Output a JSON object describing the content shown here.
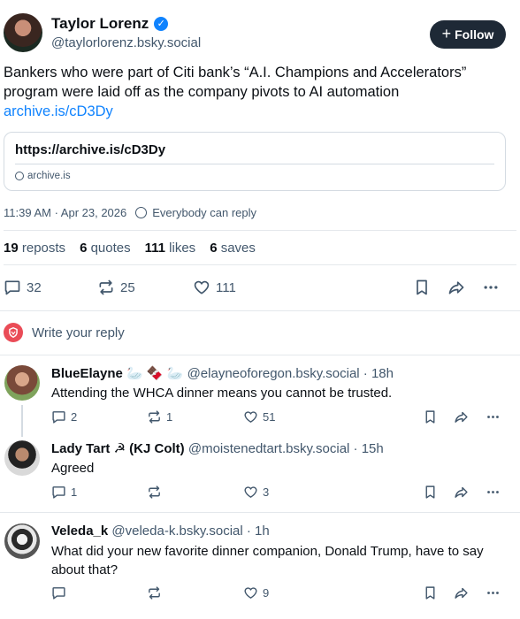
{
  "post": {
    "author_name": "Taylor Lorenz",
    "author_handle": "@taylorlorenz.bsky.social",
    "follow_label": "Follow",
    "text": "Bankers who were part of Citi bank’s “A.I. Champions and Accelerators” program were laid off as the company pivots to AI automation",
    "link_text": "archive.is/cD3Dy",
    "card": {
      "url": "https://archive.is/cD3Dy",
      "domain": "archive.is"
    },
    "timestamp": "11:39 AM · Apr 23, 2026",
    "reply_setting": "Everybody can reply",
    "stats": {
      "reposts_count": "19",
      "reposts_label": "reposts",
      "quotes_count": "6",
      "quotes_label": "quotes",
      "likes_count": "111",
      "likes_label": "likes",
      "saves_count": "6",
      "saves_label": "saves"
    },
    "actions": {
      "reply_count": "32",
      "repost_count": "25",
      "like_count": "111"
    }
  },
  "compose": {
    "placeholder": "Write your reply"
  },
  "replies": [
    {
      "name": "BlueElayne 🦢 🍫 🦢",
      "handle": "@elayneoforegon.bsky.social · 18h",
      "text": "Attending the WHCA dinner means you cannot be trusted.",
      "reply_count": "2",
      "repost_count": "1",
      "like_count": "51"
    },
    {
      "name": "Lady Tart ☭ (KJ Colt)",
      "handle": "@moistenedtart.bsky.social · 15h",
      "text": "Agreed",
      "reply_count": "1",
      "repost_count": "",
      "like_count": "3"
    },
    {
      "name": "Veleda_k",
      "handle": "@veleda-k.bsky.social · 1h",
      "text": "What did your new favorite dinner companion, Donald Trump, have to say about that?",
      "reply_count": "",
      "repost_count": "",
      "like_count": "9"
    }
  ],
  "colors": {
    "accent": "#1083fe",
    "follow_bg": "#1e2936",
    "muted": "#42576c",
    "reply_avatar": "#ea4c57"
  }
}
